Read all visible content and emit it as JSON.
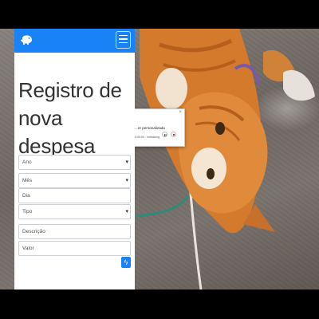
{
  "page": {
    "title": "Registro de nova despesa"
  },
  "navbar": {
    "brand_icon": "piggy-bank-icon",
    "menu_icon": "hamburger-icon",
    "accent": "#1a82f7"
  },
  "form": {
    "ano_placeholder": "Ano",
    "mes_placeholder": "Mês",
    "dia_placeholder": "Dia",
    "tipo_placeholder": "Tipo",
    "descricao_placeholder": "Descrição",
    "valor_placeholder": "Valor",
    "submit_icon": "bolt-icon"
  },
  "recording_dialog": {
    "name": "...re personalizada",
    "time": "0:00:00 · Initializing",
    "close": "×"
  }
}
